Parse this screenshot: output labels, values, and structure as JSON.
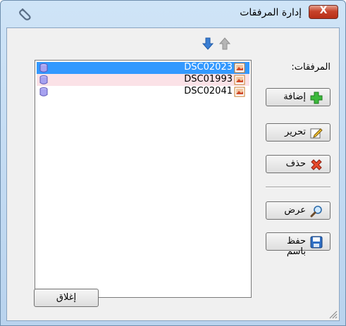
{
  "window": {
    "title": "إدارة المرفقات",
    "close_label": "X"
  },
  "attachments": {
    "label": "المرفقات:",
    "items": [
      {
        "name": "DSC02023",
        "selected": true
      },
      {
        "name": "DSC01993",
        "selected": false
      },
      {
        "name": "DSC02041",
        "selected": false
      }
    ]
  },
  "buttons": {
    "add": "إضافة",
    "edit": "تحرير",
    "delete": "حذف",
    "view": "عرض",
    "save_as": "حفظ باسم",
    "close": "إغلاق"
  },
  "icons": {
    "title": "paperclip-icon",
    "move_up": "arrow-up-icon",
    "move_down": "arrow-down-icon"
  },
  "colors": {
    "selection": "#3399ff",
    "alt_row": "#fbe2e7",
    "close_red": "#c7422a"
  }
}
